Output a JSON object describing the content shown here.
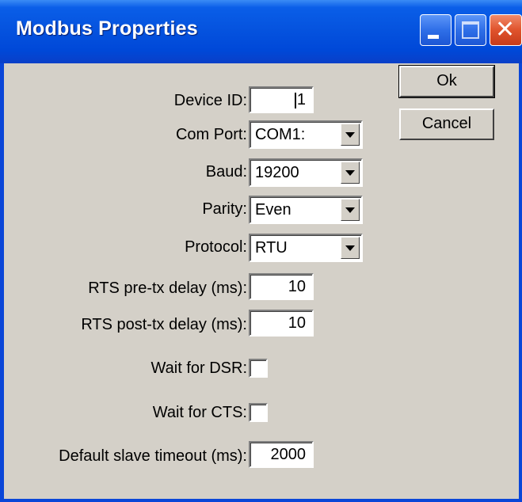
{
  "window": {
    "title": "Modbus Properties"
  },
  "buttons": {
    "ok_label": "Ok",
    "cancel_label": "Cancel"
  },
  "fields": {
    "device_id": {
      "label": "Device ID:",
      "value": "1"
    },
    "com_port": {
      "label": "Com Port:",
      "value": "COM1:"
    },
    "baud": {
      "label": "Baud:",
      "value": "19200"
    },
    "parity": {
      "label": "Parity:",
      "value": "Even"
    },
    "protocol": {
      "label": "Protocol:",
      "value": "RTU"
    },
    "rts_pre": {
      "label": "RTS pre-tx delay (ms):",
      "value": "10"
    },
    "rts_post": {
      "label": "RTS post-tx delay (ms):",
      "value": "10"
    },
    "wait_dsr": {
      "label": "Wait for DSR:",
      "checked": false
    },
    "wait_cts": {
      "label": "Wait for CTS:",
      "checked": false
    },
    "slave_timeout": {
      "label": "Default slave timeout (ms):",
      "value": "2000"
    }
  },
  "icons": {
    "minimize": "minimize-icon",
    "maximize": "maximize-icon",
    "close": "close-icon"
  },
  "colors": {
    "titlebar": "#0a5ee8",
    "client": "#d4d0c8",
    "close_button": "#e0532c"
  }
}
